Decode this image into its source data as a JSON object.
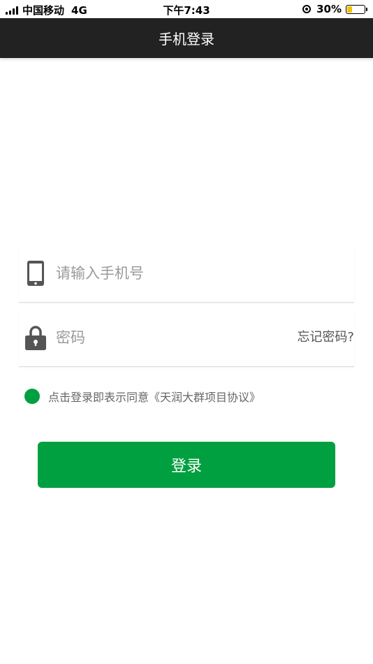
{
  "status_bar": {
    "carrier": "中国移动",
    "network": "4G",
    "time": "下午7:43",
    "battery": "30%",
    "battery_level": 0.3,
    "battery_color": "#f2c200"
  },
  "header": {
    "title": "手机登录"
  },
  "form": {
    "phone_placeholder": "请输入手机号",
    "password_placeholder": "密码",
    "forgot_label": "忘记密码?",
    "agreement_text": "点击登录即表示同意《天润大群项目协议》",
    "login_label": "登录"
  },
  "colors": {
    "nav_bg": "#222222",
    "accent": "#00a040"
  },
  "icons": [
    "signal-icon",
    "orientation-lock-icon",
    "battery-icon",
    "phone-icon",
    "lock-icon",
    "check-dot-icon"
  ]
}
